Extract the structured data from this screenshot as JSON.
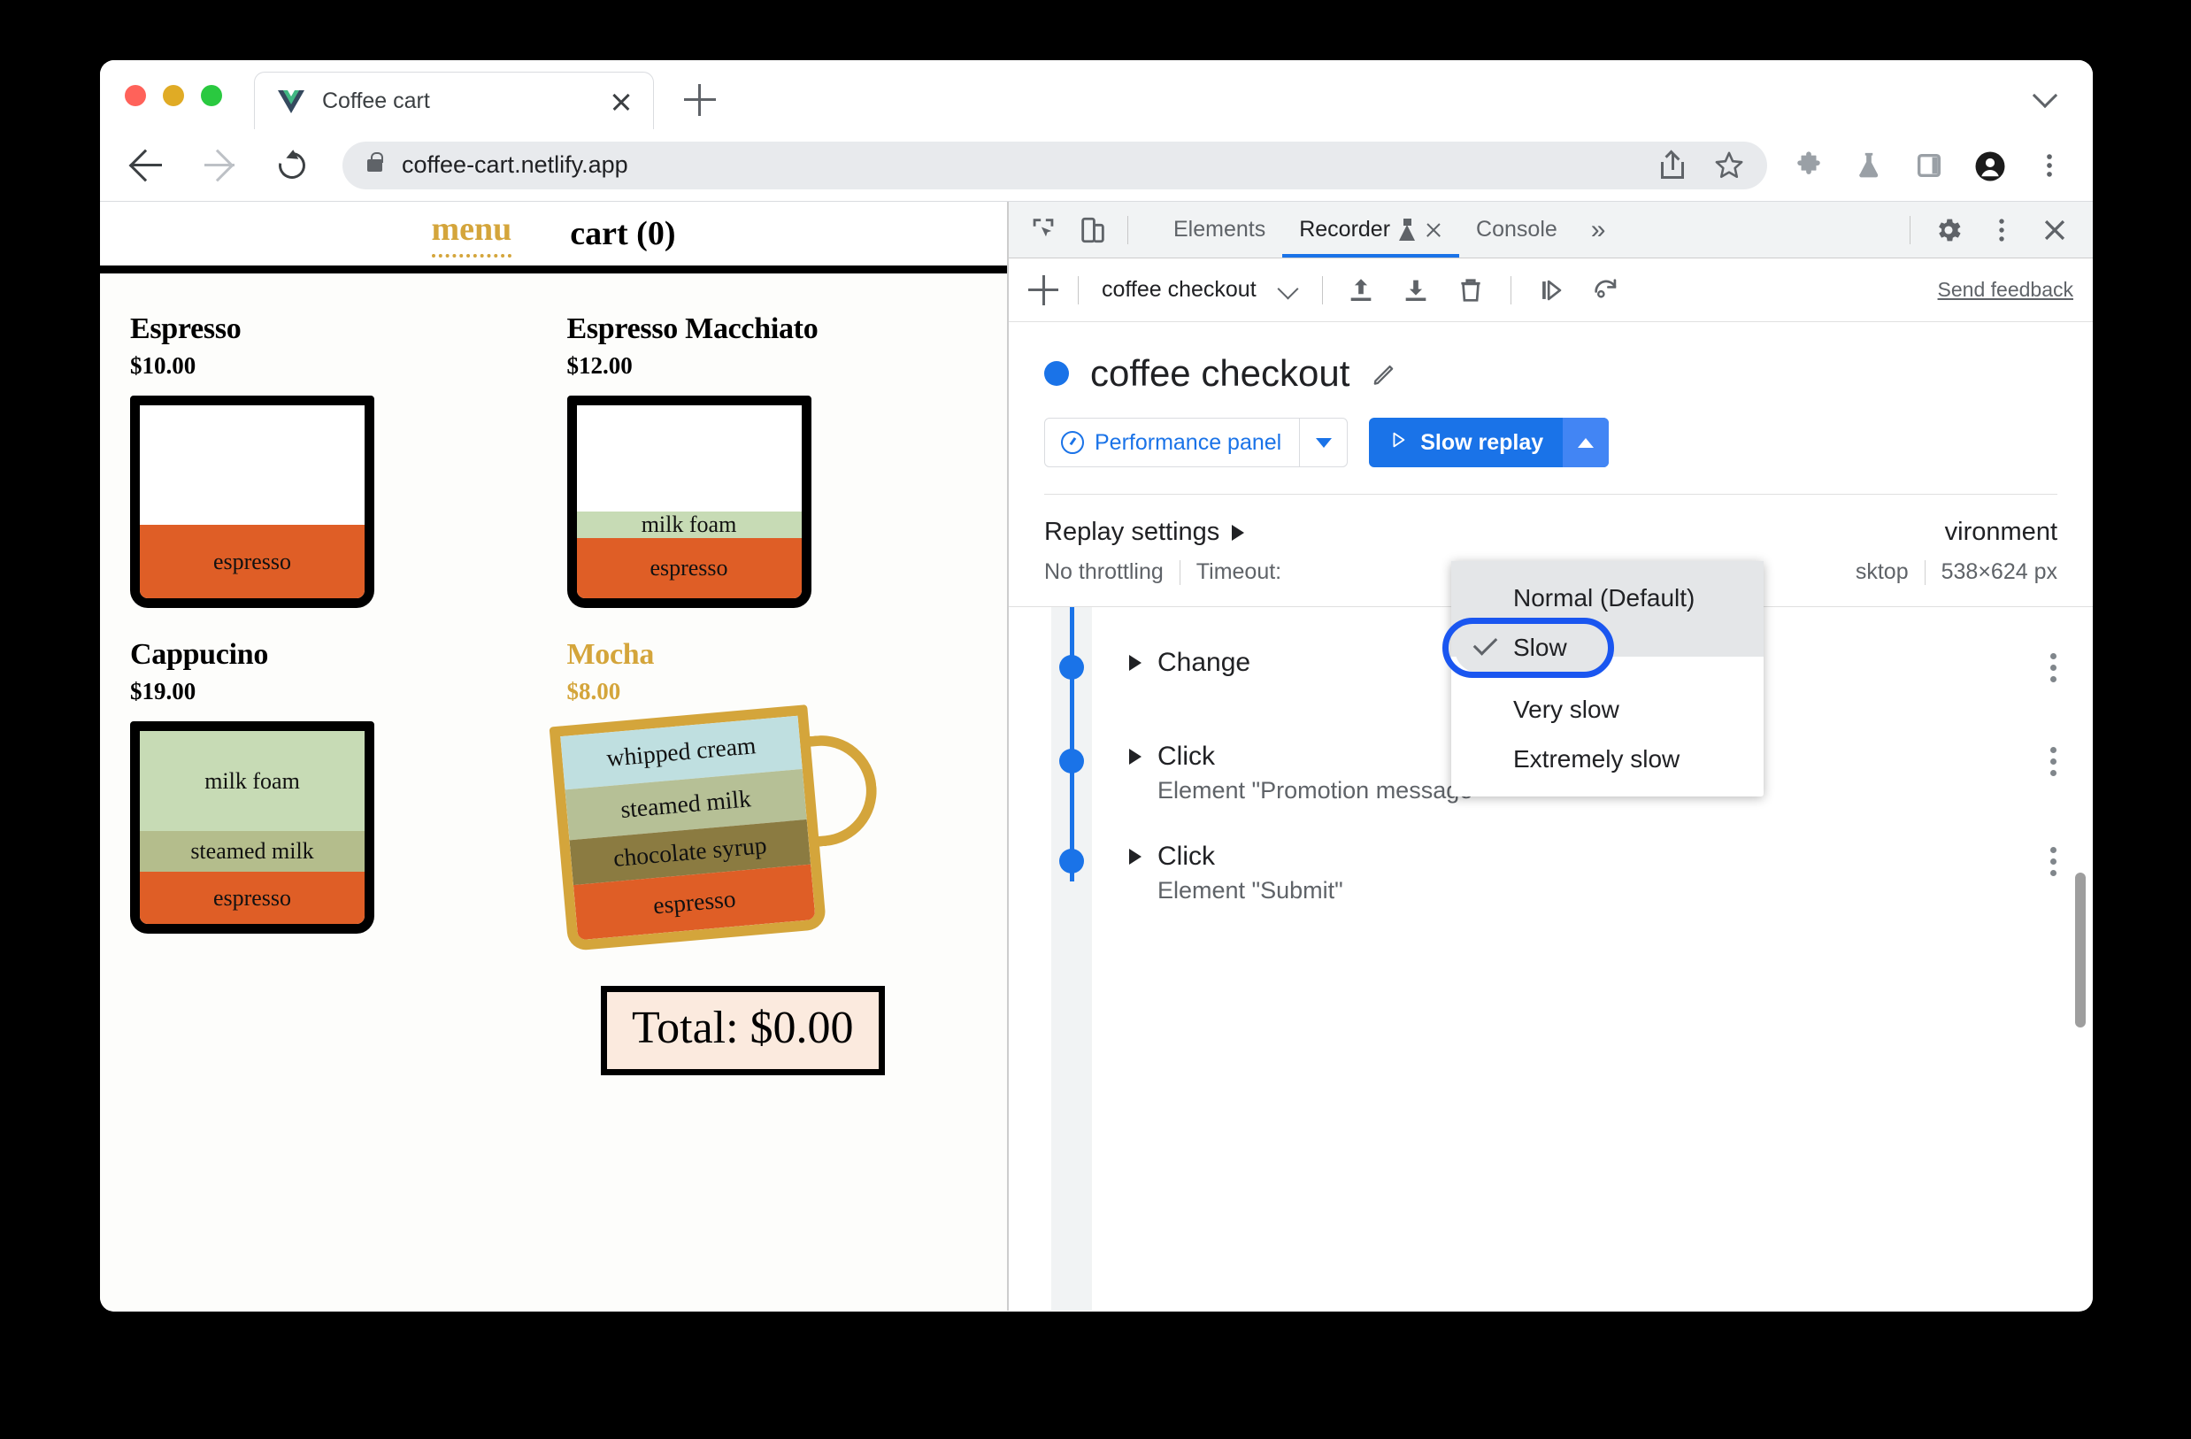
{
  "browser": {
    "tab": {
      "title": "Coffee cart",
      "favicon": "vue-logo-icon"
    },
    "new_tab_label": "+",
    "url": "coffee-cart.netlify.app",
    "toolbar_icons": [
      "share-icon",
      "bookmark-star-icon",
      "extensions-puzzle-icon",
      "experiments-flask-icon",
      "side-panel-icon",
      "profile-avatar-icon",
      "chrome-menu-icon"
    ]
  },
  "site": {
    "nav": {
      "menu": "menu",
      "cart": "cart (0)"
    },
    "total": "Total: $0.00",
    "products": [
      {
        "name": "Espresso",
        "price": "$10.00",
        "highlighted": false,
        "layers": [
          {
            "label": "",
            "color": "#ffffff",
            "pct": 62
          },
          {
            "label": "espresso",
            "color": "#df5e26",
            "pct": 38
          }
        ]
      },
      {
        "name": "Espresso Macchiato",
        "price": "$12.00",
        "highlighted": false,
        "layers": [
          {
            "label": "",
            "color": "#ffffff",
            "pct": 55
          },
          {
            "label": "milk foam",
            "color": "#c7dbb5",
            "pct": 14
          },
          {
            "label": "espresso",
            "color": "#df5e26",
            "pct": 31
          }
        ]
      },
      {
        "name": "Cappucino",
        "price": "$19.00",
        "highlighted": false,
        "layers": [
          {
            "label": "milk foam",
            "color": "#c7dbb5",
            "pct": 52
          },
          {
            "label": "steamed milk",
            "color": "#b4bd8c",
            "pct": 21
          },
          {
            "label": "espresso",
            "color": "#df5e26",
            "pct": 27
          }
        ]
      },
      {
        "name": "Mocha",
        "price": "$8.00",
        "highlighted": true,
        "layers": [
          {
            "label": "whipped cream",
            "color": "#bfdfe0",
            "pct": 26
          },
          {
            "label": "steamed milk",
            "color": "#b6c096",
            "pct": 25
          },
          {
            "label": "chocolate syrup",
            "color": "#8b7b41",
            "pct": 22
          },
          {
            "label": "espresso",
            "color": "#df5e26",
            "pct": 27
          }
        ]
      }
    ]
  },
  "devtools": {
    "tools": [
      "inspect-element-icon",
      "device-toolbar-icon"
    ],
    "tabs": [
      {
        "label": "Elements",
        "active": false,
        "flask": false,
        "closable": false
      },
      {
        "label": "Recorder",
        "active": true,
        "flask": true,
        "closable": true
      },
      {
        "label": "Console",
        "active": false,
        "flask": false,
        "closable": false
      }
    ],
    "more_tabs": "»",
    "right_icons": [
      "settings-gear-icon",
      "devtools-menu-icon",
      "close-devtools-icon"
    ],
    "recorder_toolbar": {
      "add_label": "+",
      "recording_name": "coffee checkout",
      "actions": [
        "import-icon",
        "export-icon",
        "delete-icon",
        "step-replay-icon",
        "undo-replay-icon"
      ],
      "send_feedback": "Send feedback"
    },
    "recording": {
      "title": "coffee checkout",
      "edit_icon": "pencil-icon",
      "perf_button": "Performance panel",
      "replay_button": "Slow replay"
    },
    "replay_settings": {
      "label": "Replay settings",
      "throttling": "No throttling",
      "timeout_label": "Timeout:",
      "environment_label": "vironment",
      "environment_full": "Environment",
      "device": "sktop",
      "device_full": "Desktop",
      "viewport": "538×624 px"
    },
    "speed_menu": {
      "options": [
        {
          "label": "Normal (Default)",
          "checked": false,
          "focused": false
        },
        {
          "label": "Slow",
          "checked": true,
          "focused": true
        },
        {
          "label": "Very slow",
          "checked": false,
          "focused": false
        },
        {
          "label": "Extremely slow",
          "checked": false,
          "focused": false
        }
      ]
    },
    "steps": [
      {
        "type": "Change",
        "detail": ""
      },
      {
        "type": "Click",
        "detail": "Element \"Promotion message\""
      },
      {
        "type": "Click",
        "detail": "Element \"Submit\""
      }
    ]
  },
  "colors": {
    "accent_blue": "#1a73e8",
    "focus_blue": "#1a56f0",
    "gold": "#d4a53b",
    "espresso": "#df5e26",
    "milk_foam": "#c7dbb5"
  }
}
